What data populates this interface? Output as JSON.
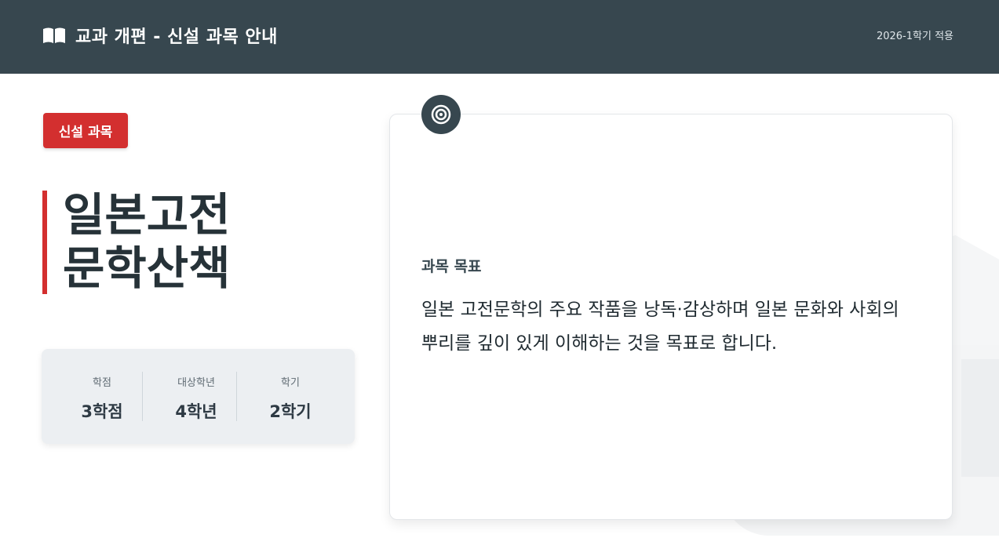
{
  "header": {
    "title": "교과 개편 - 신설 과목 안내",
    "term": "2026-1학기 적용",
    "icon": "book-icon"
  },
  "badge": {
    "label": "신설 과목",
    "color": "#d32f2f"
  },
  "course": {
    "title_line1": "일본고전",
    "title_line2": "문학산책"
  },
  "info": [
    {
      "label": "학점",
      "value": "3학점"
    },
    {
      "label": "대상학년",
      "value": "4학년"
    },
    {
      "label": "학기",
      "value": "2학기"
    }
  ],
  "goal": {
    "icon": "target-icon",
    "label": "과목 목표",
    "text": "일본 고전문학의 주요 작품을 낭독·감상하며 일본 문화와 사회의 뿌리를 깊이 있게 이해하는 것을 목표로 합니다."
  },
  "colors": {
    "header_bg": "#37474f",
    "accent": "#d32f2f",
    "card_bg": "#eceff2"
  }
}
